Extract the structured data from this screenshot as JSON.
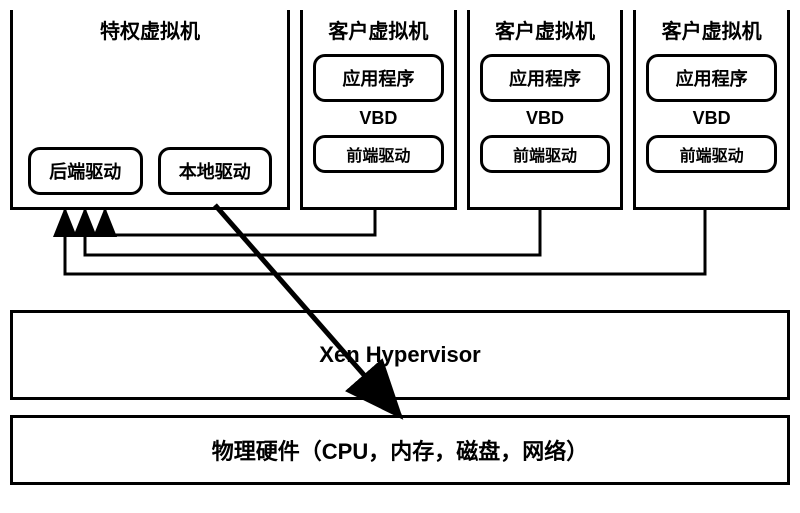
{
  "privileged_vm": {
    "title": "特权虚拟机",
    "backend_driver": "后端驱动",
    "local_driver": "本地驱动"
  },
  "guest_vms": [
    {
      "title": "客户虚拟机",
      "app": "应用程序",
      "vbd": "VBD",
      "frontend": "前端驱动"
    },
    {
      "title": "客户虚拟机",
      "app": "应用程序",
      "vbd": "VBD",
      "frontend": "前端驱动"
    },
    {
      "title": "客户虚拟机",
      "app": "应用程序",
      "vbd": "VBD",
      "frontend": "前端驱动"
    }
  ],
  "hypervisor": "Xen Hypervisor",
  "hardware": "物理硬件（CPU，内存，磁盘，网络）"
}
